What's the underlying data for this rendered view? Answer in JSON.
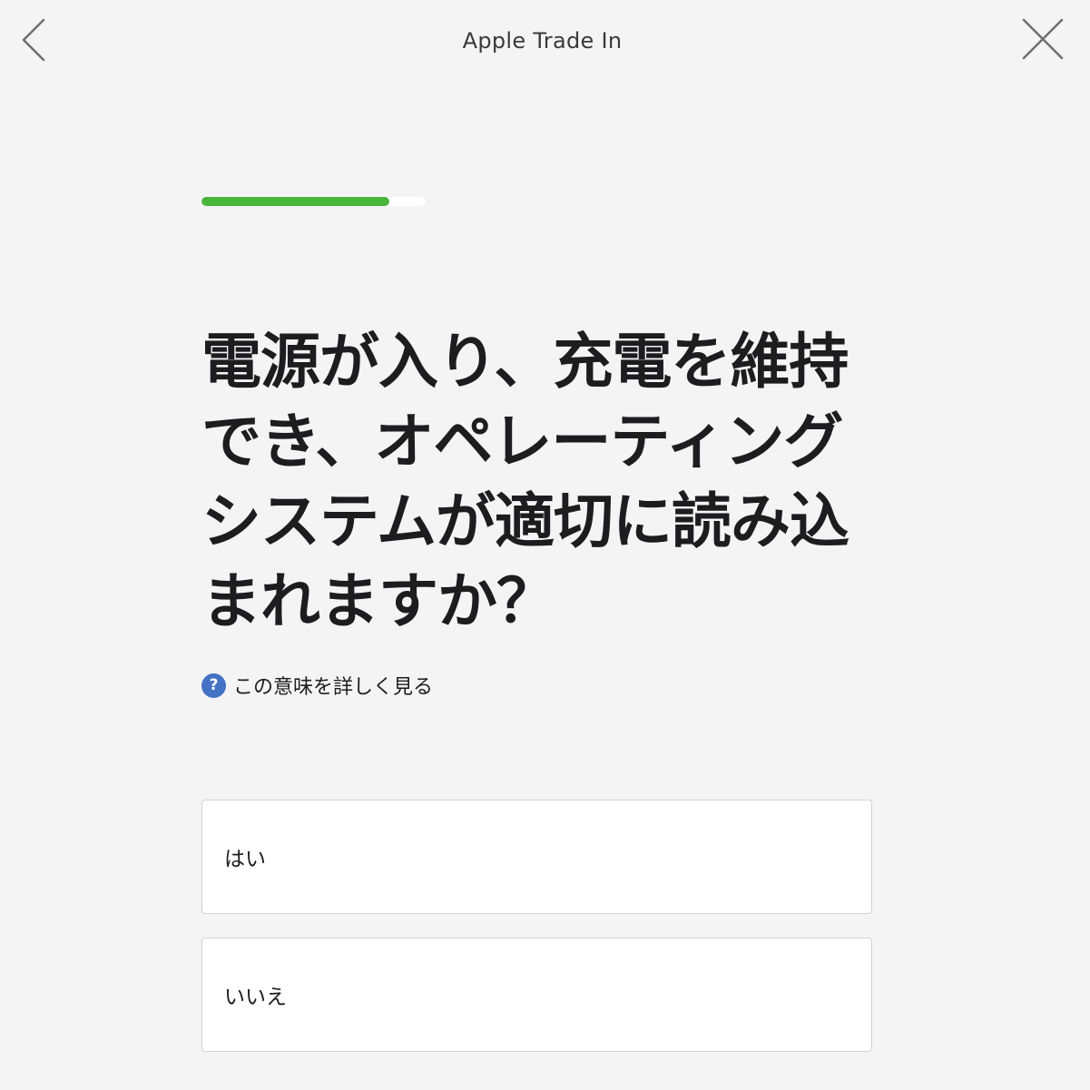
{
  "header": {
    "title": "Apple Trade In",
    "back_icon": "chevron-left-icon",
    "close_icon": "close-icon"
  },
  "progress": {
    "fraction": 0.84,
    "color": "#4ab53b"
  },
  "question": {
    "text": "電源が入り、充電を維持でき、オペレーティングシステムが適切に読み込まれますか？"
  },
  "help": {
    "icon_glyph": "?",
    "label": "この意味を詳しく見る",
    "icon_color": "#4472c4"
  },
  "options": [
    {
      "label": "はい"
    },
    {
      "label": "いいえ"
    }
  ]
}
